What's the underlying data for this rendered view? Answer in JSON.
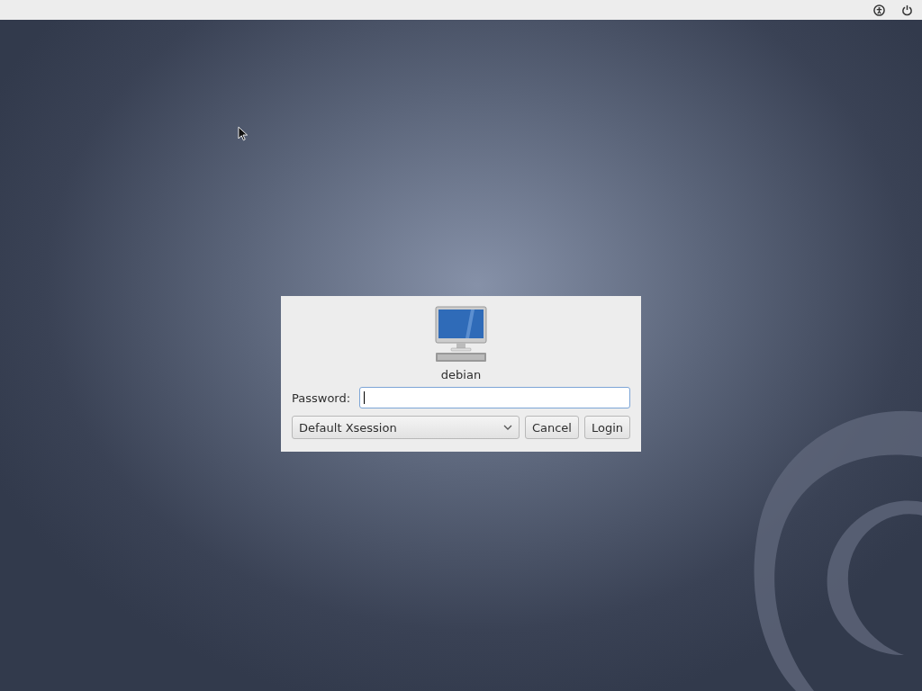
{
  "login_dialog": {
    "user_name": "debian",
    "password_label": "Password:",
    "session": "Default Xsession",
    "buttons": [
      "Cancel",
      "Login"
    ]
  }
}
